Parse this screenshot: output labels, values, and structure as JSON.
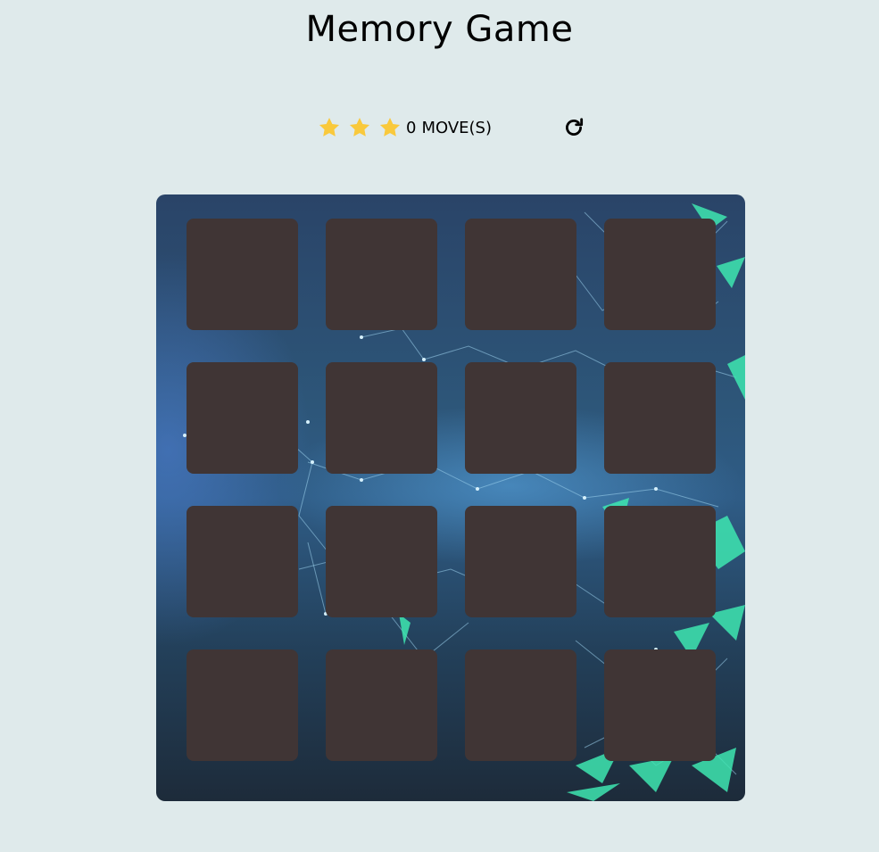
{
  "title": "Memory Game",
  "score_panel": {
    "stars": [
      {
        "name": "star-icon",
        "color": "#f9c93c"
      },
      {
        "name": "star-icon",
        "color": "#f9c93c"
      },
      {
        "name": "star-icon",
        "color": "#f9c93c"
      }
    ],
    "moves_count": "0",
    "moves_label": "MOVE(S)",
    "restart_icon": "restart-icon"
  },
  "deck": {
    "rows": 4,
    "cols": 4,
    "card_color": "#403535",
    "cards": [
      {
        "state": "hidden"
      },
      {
        "state": "hidden"
      },
      {
        "state": "hidden"
      },
      {
        "state": "hidden"
      },
      {
        "state": "hidden"
      },
      {
        "state": "hidden"
      },
      {
        "state": "hidden"
      },
      {
        "state": "hidden"
      },
      {
        "state": "hidden"
      },
      {
        "state": "hidden"
      },
      {
        "state": "hidden"
      },
      {
        "state": "hidden"
      },
      {
        "state": "hidden"
      },
      {
        "state": "hidden"
      },
      {
        "state": "hidden"
      },
      {
        "state": "hidden"
      }
    ]
  },
  "colors": {
    "background": "#dfeaeb",
    "star": "#f9c93c",
    "accent_mesh": "#3ee6b0"
  }
}
